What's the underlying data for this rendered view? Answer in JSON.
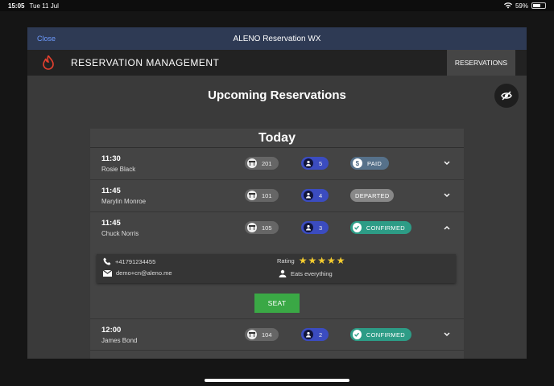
{
  "status_bar": {
    "time": "15:05",
    "date": "Tue 11 Jul",
    "battery": "59%",
    "battery_level": 0.59,
    "icons": [
      "wifi-icon",
      "battery-icon"
    ]
  },
  "modal": {
    "close_label": "Close",
    "title": "ALENO Reservation WX"
  },
  "app": {
    "name": "RESERVATION MANAGEMENT",
    "nav_button": "RESERVATIONS"
  },
  "page": {
    "title": "Upcoming Reservations",
    "section": "Today"
  },
  "reservations": [
    {
      "time": "11:30",
      "name": "Rosie Black",
      "table": "201",
      "guests": "5",
      "status": "PAID",
      "expanded": false
    },
    {
      "time": "11:45",
      "name": "Marylin Monroe",
      "table": "101",
      "guests": "4",
      "status": "DEPARTED",
      "expanded": false
    },
    {
      "time": "11:45",
      "name": "Chuck Norris",
      "table": "105",
      "guests": "3",
      "status": "CONFIRMED",
      "expanded": true
    },
    {
      "time": "12:00",
      "name": "James Bond",
      "table": "104",
      "guests": "2",
      "status": "CONFIRMED",
      "expanded": false
    }
  ],
  "details": {
    "phone": "+41791234455",
    "email": "demo+cn@aleno.me",
    "rating_label": "Rating",
    "rating": 5,
    "preference": "Eats everything",
    "seat_label": "SEAT"
  },
  "colors": {
    "modal_bar": "#2e3a54",
    "close_link": "#6e9bff",
    "paid": "#56718a",
    "departed": "#888888",
    "confirmed": "#2d9c86",
    "guests": "#3b4cc0",
    "seat": "#3aa845",
    "star": "#f5cc2f",
    "logo": "#e5402f"
  }
}
